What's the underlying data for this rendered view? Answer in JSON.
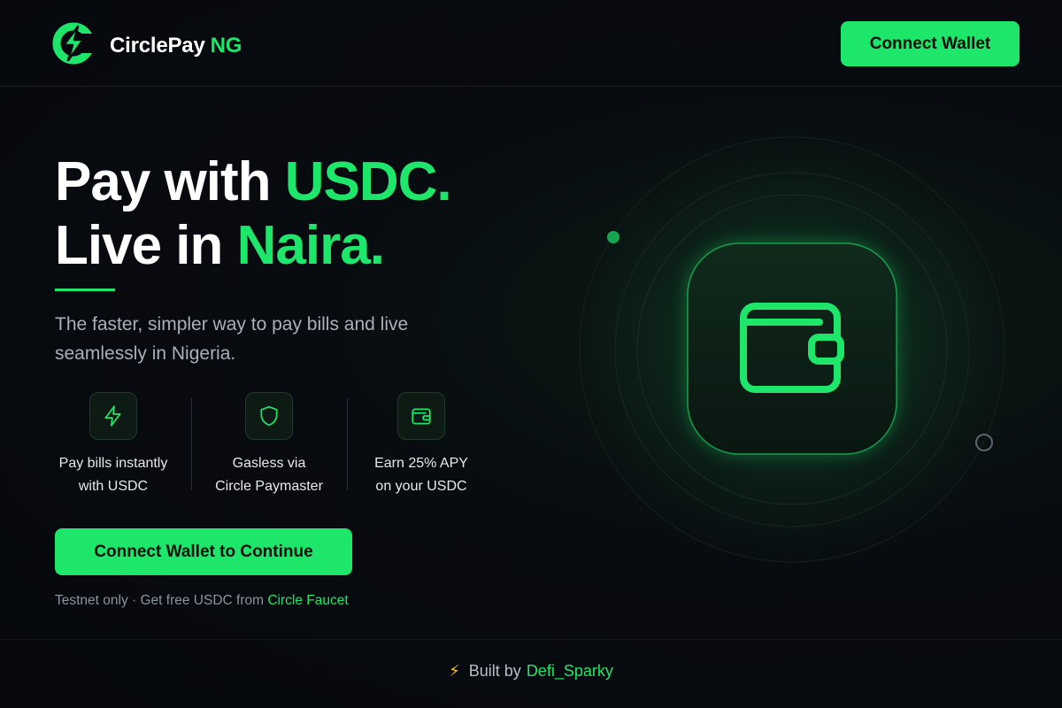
{
  "header": {
    "brand_name": "CirclePay",
    "brand_suffix": "NG",
    "connect_label": "Connect Wallet"
  },
  "hero": {
    "line1_plain": "Pay with ",
    "line1_accent": "USDC.",
    "line2_plain": "Live in ",
    "line2_accent": "Naira.",
    "subtitle": "The faster, simpler way to pay bills and live seamlessly in Nigeria."
  },
  "features": [
    {
      "icon": "lightning-icon",
      "line1": "Pay bills instantly",
      "line2": "with USDC"
    },
    {
      "icon": "shield-icon",
      "line1": "Gasless via",
      "line2": "Circle Paymaster"
    },
    {
      "icon": "wallet-icon",
      "line1": "Earn 25% APY",
      "line2": "on your USDC"
    }
  ],
  "cta": {
    "label": "Connect Wallet to Continue"
  },
  "note": {
    "text": "Testnet only · Get free USDC from ",
    "link": "Circle Faucet"
  },
  "footer": {
    "bolt": "⚡",
    "prefix": "Built by",
    "author": "Defi_Sparky"
  },
  "colors": {
    "accent": "#1ee66b",
    "background": "#07090d",
    "muted_text": "#a7b0bb"
  }
}
